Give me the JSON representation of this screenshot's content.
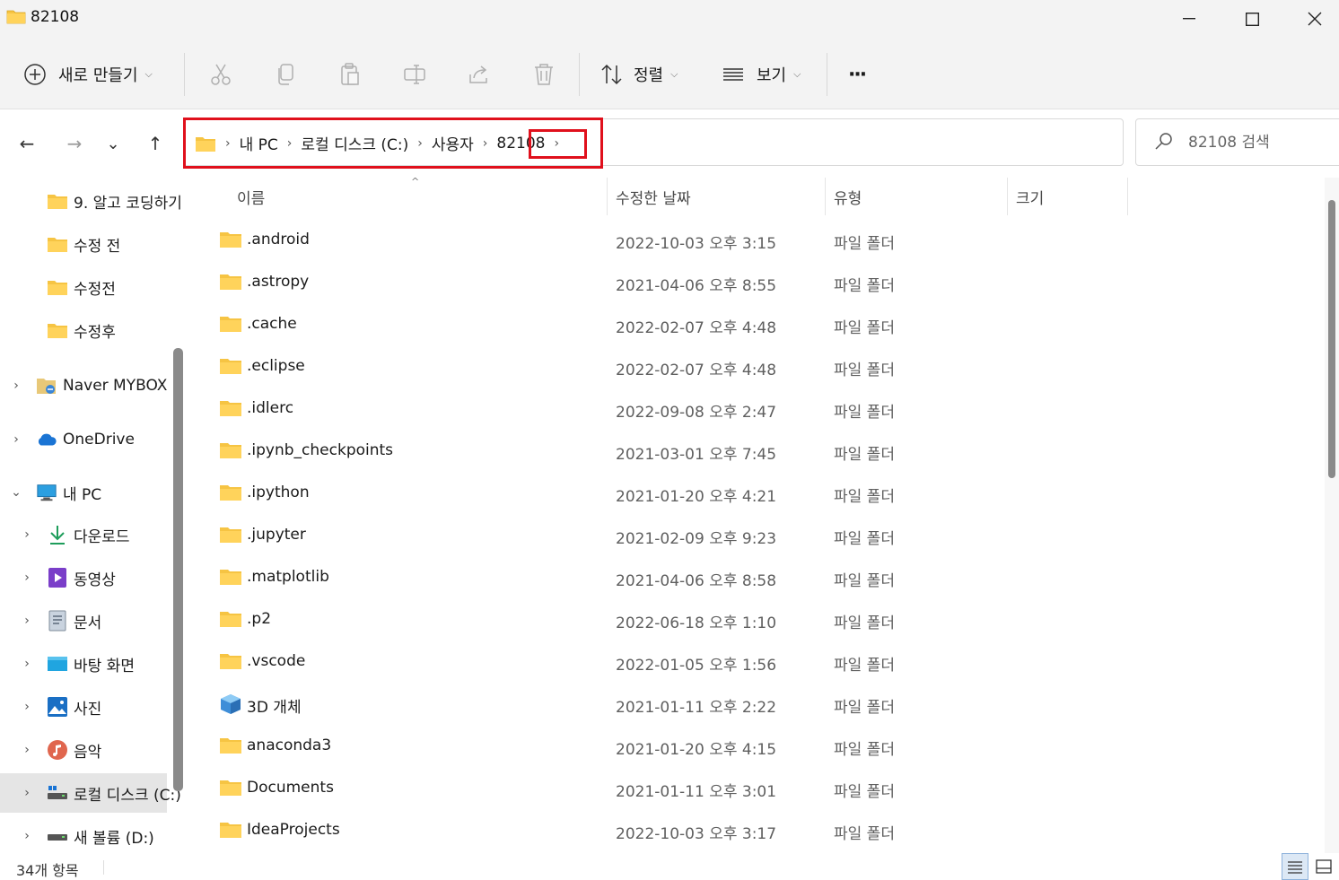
{
  "window": {
    "title": "82108",
    "minimize_glyph": "—",
    "maximize_glyph": "☐",
    "close_glyph": "✕"
  },
  "toolbar": {
    "new_label": "새로 만들기",
    "sort_label": "정렬",
    "view_label": "보기",
    "more_label": "···"
  },
  "nav": {
    "back_glyph": "←",
    "forward_glyph": "→",
    "recent_glyph": "⌄",
    "up_glyph": "↑"
  },
  "address": {
    "breadcrumbs": [
      "내 PC",
      "로컬 디스크 (C:)",
      "사용자",
      "82108"
    ],
    "separator": "›",
    "dropdown_glyph": "⌄",
    "refresh_glyph": "↻"
  },
  "search": {
    "placeholder": "82108 검색"
  },
  "sidebar": {
    "items": [
      {
        "label": "9. 알고 코딩하기",
        "icon": "folder-icon"
      },
      {
        "label": "수정 전",
        "icon": "folder-icon"
      },
      {
        "label": "수정전",
        "icon": "folder-icon"
      },
      {
        "label": "수정후",
        "icon": "folder-icon"
      },
      {
        "label": "Naver MYBOX",
        "icon": "cloud-folder-icon"
      },
      {
        "label": "OneDrive",
        "icon": "onedrive-icon"
      },
      {
        "label": "내 PC",
        "icon": "pc-icon"
      },
      {
        "label": "다운로드",
        "icon": "download-icon"
      },
      {
        "label": "동영상",
        "icon": "video-icon"
      },
      {
        "label": "문서",
        "icon": "document-icon"
      },
      {
        "label": "바탕 화면",
        "icon": "desktop-icon"
      },
      {
        "label": "사진",
        "icon": "pictures-icon"
      },
      {
        "label": "음악",
        "icon": "music-icon"
      },
      {
        "label": "로컬 디스크 (C:)",
        "icon": "drive-icon"
      },
      {
        "label": "새 볼륨 (D:)",
        "icon": "drive-icon"
      }
    ],
    "expand_glyph": "›",
    "collapse_glyph": "⌄"
  },
  "columns": {
    "name": "이름",
    "date": "수정한 날짜",
    "type": "유형",
    "size": "크기",
    "sort_indicator": "^"
  },
  "files": [
    {
      "name": ".android",
      "date": "2022-10-03 오후 3:15",
      "type": "파일 폴더"
    },
    {
      "name": ".astropy",
      "date": "2021-04-06 오후 8:55",
      "type": "파일 폴더"
    },
    {
      "name": ".cache",
      "date": "2022-02-07 오후 4:48",
      "type": "파일 폴더"
    },
    {
      "name": ".eclipse",
      "date": "2022-02-07 오후 4:48",
      "type": "파일 폴더"
    },
    {
      "name": ".idlerc",
      "date": "2022-09-08 오후 2:47",
      "type": "파일 폴더"
    },
    {
      "name": ".ipynb_checkpoints",
      "date": "2021-03-01 오후 7:45",
      "type": "파일 폴더"
    },
    {
      "name": ".ipython",
      "date": "2021-01-20 오후 4:21",
      "type": "파일 폴더"
    },
    {
      "name": ".jupyter",
      "date": "2021-02-09 오후 9:23",
      "type": "파일 폴더"
    },
    {
      "name": ".matplotlib",
      "date": "2021-04-06 오후 8:58",
      "type": "파일 폴더"
    },
    {
      "name": ".p2",
      "date": "2022-06-18 오후 1:10",
      "type": "파일 폴더"
    },
    {
      "name": ".vscode",
      "date": "2022-01-05 오후 1:56",
      "type": "파일 폴더"
    },
    {
      "name": "3D 개체",
      "date": "2021-01-11 오후 2:22",
      "type": "파일 폴더",
      "icon": "3d-objects-icon"
    },
    {
      "name": "anaconda3",
      "date": "2021-01-20 오후 4:15",
      "type": "파일 폴더"
    },
    {
      "name": "Documents",
      "date": "2021-01-11 오후 3:01",
      "type": "파일 폴더"
    },
    {
      "name": "IdeaProjects",
      "date": "2022-10-03 오후 3:17",
      "type": "파일 폴더"
    }
  ],
  "status": {
    "item_count": "34개 항목"
  },
  "colors": {
    "folder": "#f6c443",
    "highlight_box": "#e0101c",
    "selection": "#e5e5e5"
  }
}
